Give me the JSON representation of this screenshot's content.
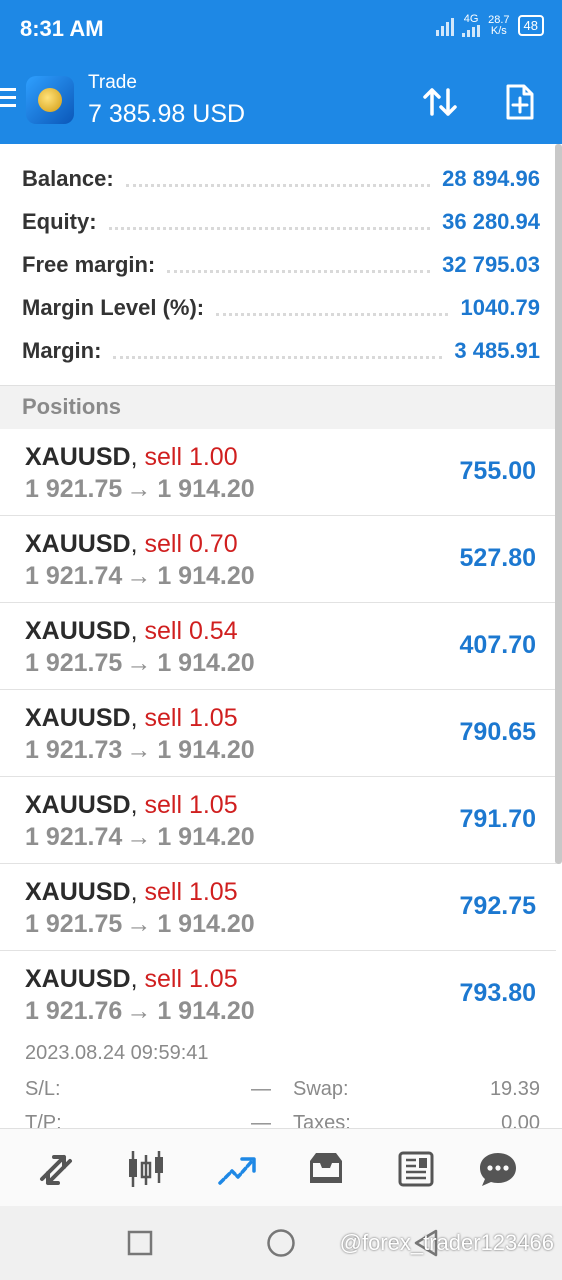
{
  "status_bar": {
    "time": "8:31 AM",
    "network_type": "4G",
    "net_speed_value": "28.7",
    "net_speed_unit": "K/s",
    "battery": "48"
  },
  "header": {
    "title": "Trade",
    "balance": "7 385.98 USD",
    "icons": [
      "menu-icon",
      "sort-icon",
      "new-order-icon"
    ]
  },
  "summary": [
    {
      "label": "Balance:",
      "value": "28 894.96"
    },
    {
      "label": "Equity:",
      "value": "36 280.94"
    },
    {
      "label": "Free margin:",
      "value": "32 795.03"
    },
    {
      "label": "Margin Level (%):",
      "value": "1040.79"
    },
    {
      "label": "Margin:",
      "value": "3 485.91"
    }
  ],
  "positions_header": "Positions",
  "positions": [
    {
      "symbol": "XAUUSD",
      "type": "sell 1.00",
      "open_price": "1 921.75",
      "arrow": "→",
      "current_price": "1 914.20",
      "profit": "755.00"
    },
    {
      "symbol": "XAUUSD",
      "type": "sell 0.70",
      "open_price": "1 921.74",
      "arrow": "→",
      "current_price": "1 914.20",
      "profit": "527.80"
    },
    {
      "symbol": "XAUUSD",
      "type": "sell 0.54",
      "open_price": "1 921.75",
      "arrow": "→",
      "current_price": "1 914.20",
      "profit": "407.70"
    },
    {
      "symbol": "XAUUSD",
      "type": "sell 1.05",
      "open_price": "1 921.73",
      "arrow": "→",
      "current_price": "1 914.20",
      "profit": "790.65"
    },
    {
      "symbol": "XAUUSD",
      "type": "sell 1.05",
      "open_price": "1 921.74",
      "arrow": "→",
      "current_price": "1 914.20",
      "profit": "791.70"
    },
    {
      "symbol": "XAUUSD",
      "type": "sell 1.05",
      "open_price": "1 921.75",
      "arrow": "→",
      "current_price": "1 914.20",
      "profit": "792.75"
    },
    {
      "symbol": "XAUUSD",
      "type": "sell 1.05",
      "open_price": "1 921.76",
      "arrow": "→",
      "current_price": "1 914.20",
      "profit": "793.80"
    }
  ],
  "position_detail": {
    "time": "2023.08.24 09:59:41",
    "sl_label": "S/L:",
    "sl_value": "—",
    "swap_label": "Swap:",
    "swap_value": "19.39",
    "tp_label": "T/P:",
    "tp_value": "—",
    "taxes_label": "Taxes:",
    "taxes_value": "0.00"
  },
  "bottom_nav": [
    {
      "name": "quotes",
      "icon": "quotes-arrows-icon",
      "active": false
    },
    {
      "name": "chart",
      "icon": "candlestick-chart-icon",
      "active": false
    },
    {
      "name": "trade",
      "icon": "trade-trend-icon",
      "active": true
    },
    {
      "name": "history",
      "icon": "history-inbox-icon",
      "active": false
    },
    {
      "name": "news",
      "icon": "news-icon",
      "active": false
    },
    {
      "name": "messages",
      "icon": "chat-icon",
      "active": false
    }
  ],
  "system_nav": {
    "icons": [
      "recents-square-icon",
      "home-circle-icon",
      "back-triangle-icon"
    ],
    "watermark": "@forex_trader123466"
  },
  "colors": {
    "brand_blue": "#1e88e5",
    "value_blue": "#1c78d0",
    "sell_red": "#d01f1f",
    "grey_text": "#8f8f8f"
  }
}
